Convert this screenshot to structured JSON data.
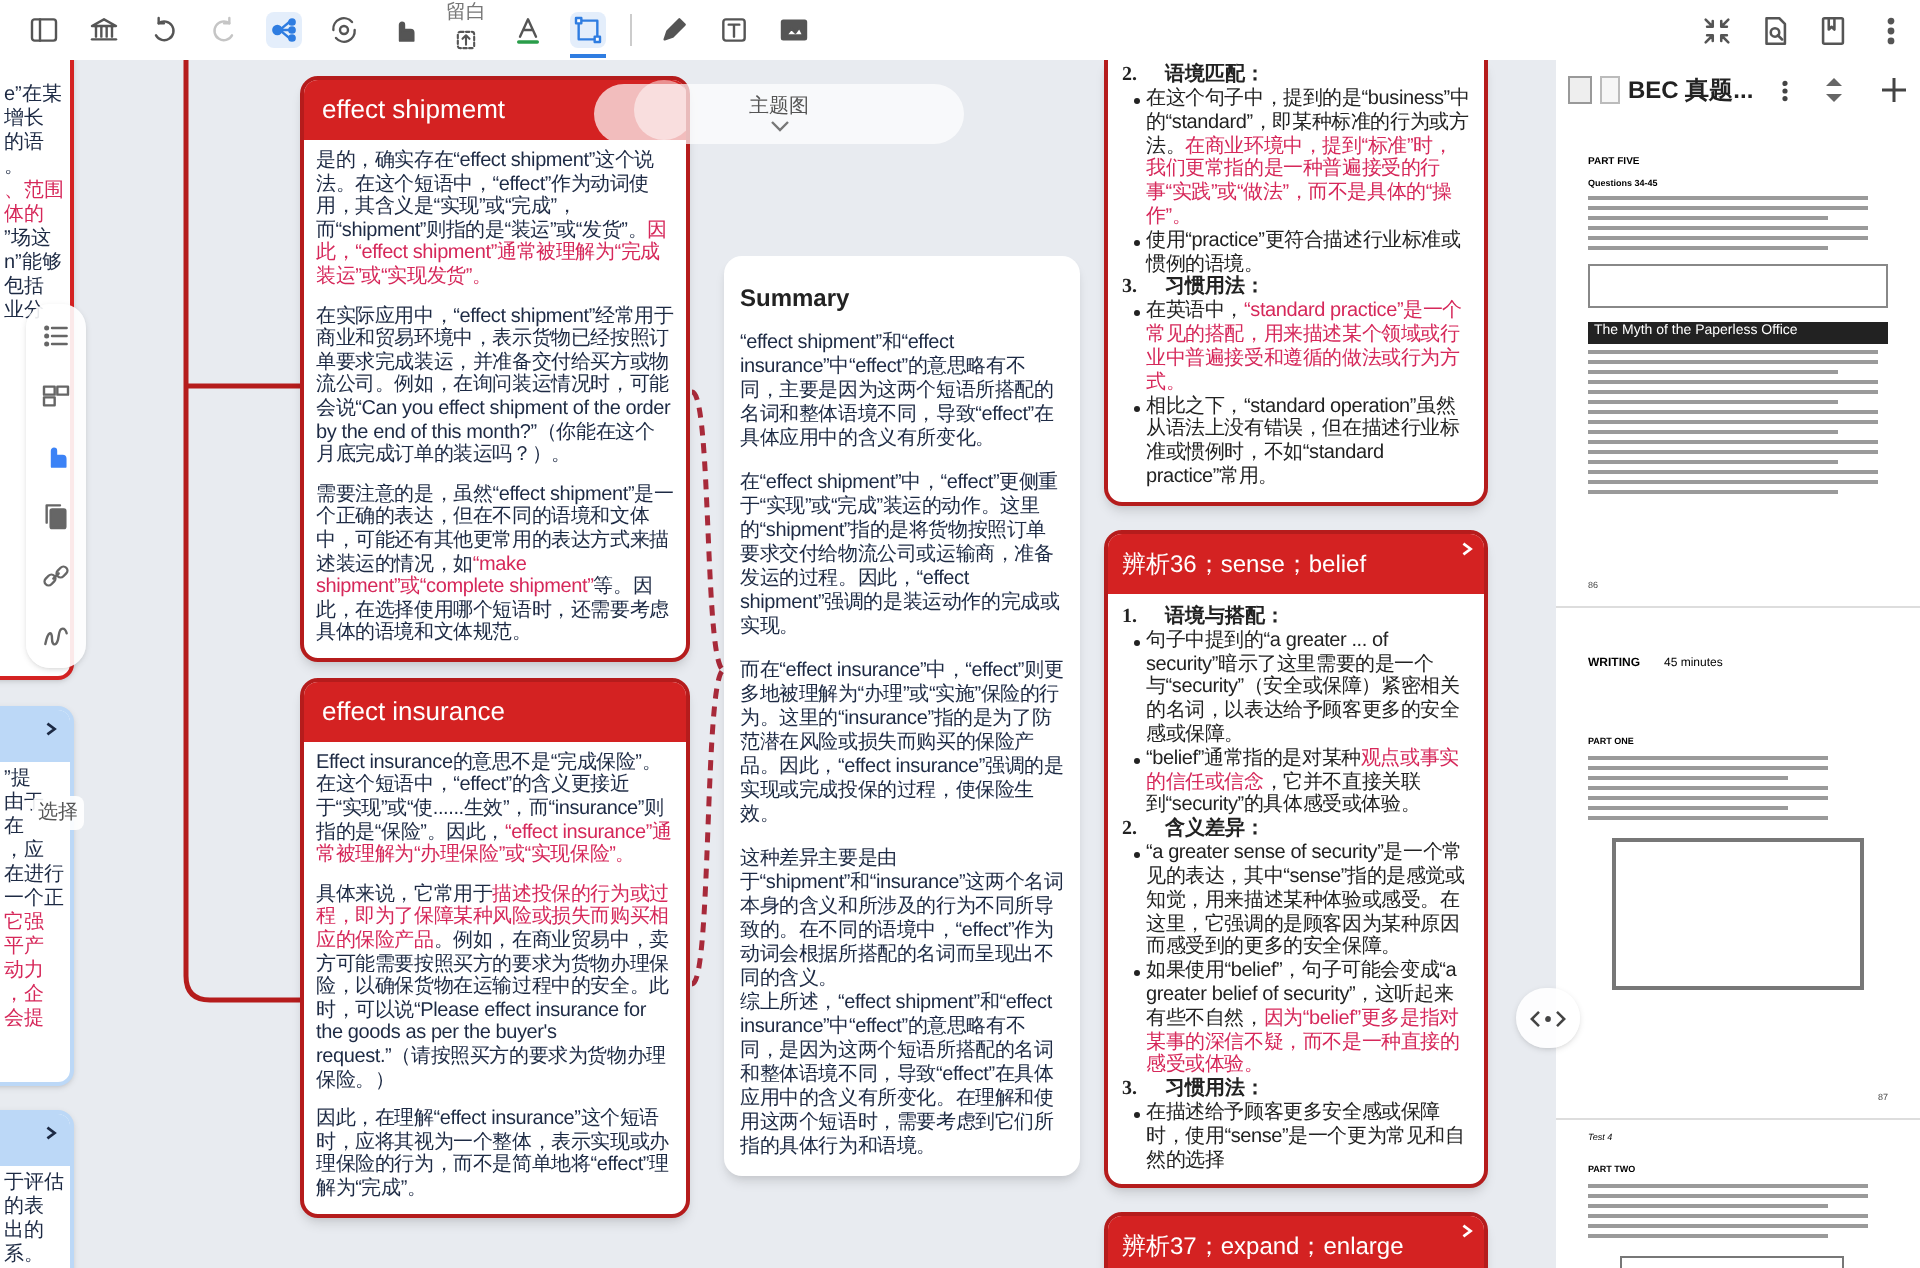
{
  "toolbar": {
    "tools": [
      {
        "kind": "sidebar",
        "selected": false,
        "disabled": false
      },
      {
        "kind": "library",
        "selected": false,
        "disabled": false
      },
      {
        "kind": "undo",
        "selected": false,
        "disabled": false
      },
      {
        "kind": "redo",
        "selected": false,
        "disabled": true
      },
      {
        "kind": "mindmap",
        "selected": true,
        "disabled": false
      },
      {
        "kind": "rotate",
        "selected": false,
        "disabled": false
      },
      {
        "kind": "hand",
        "selected": false,
        "disabled": false
      },
      {
        "kind": "frame",
        "selected": false,
        "disabled": false,
        "label": "留白"
      },
      {
        "kind": "textcolor",
        "selected": false,
        "disabled": false
      },
      {
        "kind": "rect",
        "selected": true,
        "disabled": false
      },
      {
        "kind": "pen",
        "selected": false,
        "disabled": false
      },
      {
        "kind": "textbox",
        "selected": false,
        "disabled": false
      },
      {
        "kind": "image",
        "selected": false,
        "disabled": false
      }
    ],
    "right_tools": [
      {
        "kind": "collapse"
      },
      {
        "kind": "docsearch"
      },
      {
        "kind": "bookmark"
      },
      {
        "kind": "more"
      }
    ]
  },
  "topic_tab": {
    "label": "主题图"
  },
  "left_cards": [
    {
      "color": "#d42222",
      "lines": [
        {
          "text": "e”在某",
          "emphasis": false
        },
        {
          "text": "增长",
          "emphasis": false
        },
        {
          "text": "的语",
          "emphasis": false
        },
        {
          "text": "。",
          "emphasis": false
        },
        {
          "text": "、范围",
          "emphasis": true
        },
        {
          "text": "体的",
          "emphasis": true
        },
        {
          "text": "”场这",
          "emphasis": false
        },
        {
          "text": "n”能够",
          "emphasis": false
        },
        {
          "text": "包括",
          "emphasis": false
        },
        {
          "text": "业分",
          "emphasis": false
        }
      ]
    },
    {
      "color": "#bcd8f7",
      "lines": [
        {
          "text": "”提",
          "emphasis": false
        },
        {
          "text": "由于",
          "emphasis": false
        },
        {
          "text": "在",
          "emphasis": false
        },
        {
          "text": "，应",
          "emphasis": false
        },
        {
          "text": "在进行",
          "emphasis": false
        },
        {
          "text": "一个正",
          "emphasis": false
        },
        {
          "text": "它强",
          "emphasis": true
        },
        {
          "text": "平产",
          "emphasis": true
        },
        {
          "text": "动力",
          "emphasis": true
        },
        {
          "text": "，企",
          "emphasis": true
        },
        {
          "text": "会提",
          "emphasis": true
        }
      ]
    },
    {
      "color": "#bcd8f7",
      "lines": [
        {
          "text": "于评估",
          "emphasis": false
        },
        {
          "text": "的表",
          "emphasis": false
        },
        {
          "text": "出的",
          "emphasis": false
        },
        {
          "text": "系。",
          "emphasis": false
        }
      ]
    }
  ],
  "floating_tools": [
    {
      "kind": "list"
    },
    {
      "kind": "layout"
    },
    {
      "kind": "hand"
    },
    {
      "kind": "copy"
    },
    {
      "kind": "link"
    },
    {
      "kind": "squiggle"
    }
  ],
  "tooltip": {
    "label": "选择"
  },
  "nodes": [
    {
      "title": "effect shipmemt",
      "paragraphs": [
        [
          {
            "text": "是的，确实存在“effect shipment”这个说法。在这个短语中，“effect”作为动词使用，其含义是“实现”或“完成”，而“shipment”则指的是“装运”或“发货”。",
            "emphasis": false
          },
          {
            "text": "因此，“effect shipment”通常被理解为“完成装运”或“实现发货”。",
            "emphasis": true
          }
        ],
        [
          {
            "text": "在实际应用中，“effect shipment”经常用于商业和贸易环境中，表示货物已经按照订单要求完成装运，并准备交付给买方或物流公司。例如，在询问装运情况时，可能会说“Can you effect shipment of the order by the end of this month?”（你能在这个月底完成订单的装运吗？）。",
            "emphasis": false
          }
        ],
        [
          {
            "text": "需要注意的是，虽然“effect shipment”是一个正确的表达，但在不同的语境和文体中，可能还有其他更常用的表达方式来描述装运的情况，如",
            "emphasis": false
          },
          {
            "text": "“make shipment”或“complete shipment”",
            "emphasis": true
          },
          {
            "text": "等。因此，在选择使用哪个短语时，还需要考虑具体的语境和文体规范。",
            "emphasis": false
          }
        ]
      ]
    },
    {
      "title": "effect insurance",
      "paragraphs": [
        [
          {
            "text": "Effect insurance的意思不是“完成保险”。在这个短语中，“effect”的含义更接近于“实现”或“使......生效”，而“insurance”则指的是“保险”。因此，",
            "emphasis": false
          },
          {
            "text": "“effect insurance”通常被理解为“办理保险”或“实现保险”。",
            "emphasis": true
          }
        ],
        [
          {
            "text": "具体来说，它常用于",
            "emphasis": false
          },
          {
            "text": "描述投保的行为或过程，即为了保障某种风险或损失而购买相应的保险产品",
            "emphasis": true
          },
          {
            "text": "。例如，在商业贸易中，卖方可能需要按照买方的要求为货物办理保险，以确保货物在运输过程中的安全。此时，可以说“Please effect insurance for the goods as per the buyer's request.”（请按照买方的要求为货物办理保险。）",
            "emphasis": false
          }
        ],
        [
          {
            "text": "因此，在理解“effect insurance”这个短语时，应将其视为一个整体，表示实现或办理保险的行为，而不是简单地将“effect”理解为“完成”。",
            "emphasis": false
          }
        ]
      ]
    }
  ],
  "summary": {
    "title": "Summary",
    "paragraphs": [
      {
        "text": "“effect shipment”和“effect insurance”中“effect”的意思略有不同，主要是因为这两个短语所搭配的名词和整体语境不同，导致“effect”在具体应用中的含义有所变化。",
        "spaced": false
      },
      {
        "text": "在“effect shipment”中，“effect”更侧重于“实现”或“完成”装运的动作。这里的“shipment”指的是将货物按照订单要求交付给物流公司或运输商，准备发运的过程。因此，“effect shipment”强调的是装运动作的完成或实现。",
        "spaced": true
      },
      {
        "text": "而在“effect insurance”中，“effect”则更多地被理解为“办理”或“实施”保险的行为。这里的“insurance”指的是为了防范潜在风险或损失而购买的保险产品。因此，“effect insurance”强调的是实现或完成投保的过程，使保险生效。",
        "spaced": true
      },
      {
        "text": "这种差异主要是由于“shipment”和“insurance”这两个名词本身的含义和所涉及的行为不同所导致的。在不同的语境中，“effect”作为动词会根据所搭配的名词而呈现出不同的含义。",
        "spaced": true
      },
      {
        "text": "综上所述，“effect shipment”和“effect insurance”中“effect”的意思略有不同，是因为这两个短语所搭配的名词和整体语境不同，导致“effect”在具体应用中的含义有所变化。在理解和使用这两个短语时，需要考虑到它们所指的具体行为和语境。",
        "spaced": false
      }
    ]
  },
  "right_cards": [
    {
      "sections": [
        {
          "number": "2.",
          "heading": "语境匹配：",
          "bullets": [
            [
              {
                "text": "在这个句子中，提到的是“business”中的“standard”，即某种标准的行为或方法。",
                "emphasis": false
              },
              {
                "text": "在商业环境中，提到“标准”时，我们更常指的是一种普遍接受的行事“实践”或“做法”，而不是具体的“操作”。",
                "emphasis": true
              }
            ],
            [
              {
                "text": "使用“practice”更符合描述行业标准或惯例的语境。",
                "emphasis": false
              }
            ]
          ]
        },
        {
          "number": "3.",
          "heading": "习惯用法：",
          "bullets": [
            [
              {
                "text": "在英语中，",
                "emphasis": false
              },
              {
                "text": "“standard practice”是一个常见的搭配，用来描述某个领域或行业中普遍接受和遵循的做法或行为方式。",
                "emphasis": true
              }
            ],
            [
              {
                "text": "相比之下，“standard operation”虽然从语法上没有错误，但在描述行业标准或惯例时，不如“standard practice”常用。",
                "emphasis": false
              }
            ]
          ]
        }
      ]
    },
    {
      "title": "辨析36；sense；belief",
      "sections": [
        {
          "number": "1.",
          "heading": "语境与搭配：",
          "bullets": [
            [
              {
                "text": "句子中提到的“a greater ... of security”暗示了这里需要的是一个与“security”（安全或保障）紧密相关的名词，以表达给予顾客更多的安全感或保障。",
                "emphasis": false
              }
            ],
            [
              {
                "text": "“belief”通常指的是对某种",
                "emphasis": false
              },
              {
                "text": "观点或事实的信任或信念",
                "emphasis": true
              },
              {
                "text": "，它并不直接关联到“security”的具体感受或体验。",
                "emphasis": false
              }
            ]
          ]
        },
        {
          "number": "2.",
          "heading": "含义差异：",
          "bullets": [
            [
              {
                "text": "“a greater sense of security”是一个常见的表达，其中“sense”指的是感觉或知觉，用来描述某种体验或感受。在这里，它强调的是顾客因为某种原因而感受到的更多的安全保障。",
                "emphasis": false
              }
            ],
            [
              {
                "text": "如果使用“belief”，句子可能会变成“a greater belief of security”，这听起来有些不自然，",
                "emphasis": false
              },
              {
                "text": "因为“belief”更多是指对某事的深信不疑，而不是一种直接的感受或体验。",
                "emphasis": true
              }
            ]
          ]
        },
        {
          "number": "3.",
          "heading": "习惯用法：",
          "bullets": [
            [
              {
                "text": "在描述给予顾客更多安全感或保障时，使用“sense”是一个更为常见和自然的选择",
                "emphasis": false
              }
            ]
          ]
        }
      ]
    },
    {
      "title": "辨析37；expand；enlarge"
    }
  ],
  "document": {
    "title": "BEC 真题...",
    "pages": [
      {
        "kind": "reading",
        "part": "PART FIVE",
        "subtitle": "Questions 34-45",
        "banner": "The Myth of the Paperless Office",
        "page_number": "86"
      },
      {
        "kind": "writing",
        "heading": "WRITING",
        "duration": "45 minutes",
        "part": "PART ONE",
        "page_number": "87"
      },
      {
        "kind": "writing2",
        "header": "Test 4",
        "part": "PART TWO"
      }
    ]
  }
}
